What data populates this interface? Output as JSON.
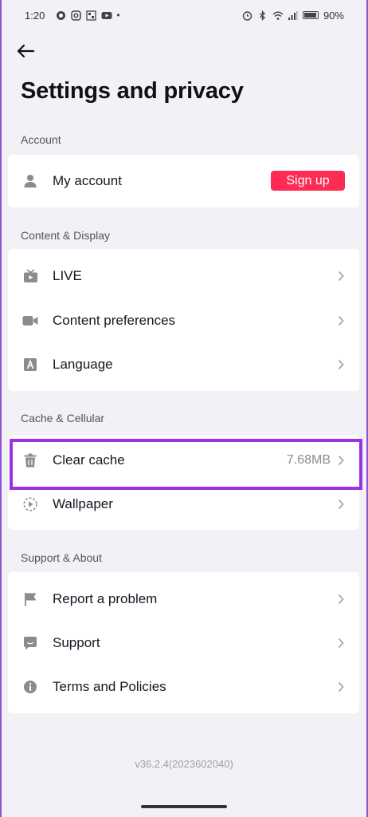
{
  "status_bar": {
    "time": "1:20",
    "battery_text": "90%"
  },
  "page": {
    "title": "Settings and privacy"
  },
  "sections": [
    {
      "label": "Account",
      "items": [
        {
          "label": "My account",
          "icon": "person-icon",
          "action_label": "Sign up"
        }
      ]
    },
    {
      "label": "Content & Display",
      "items": [
        {
          "label": "LIVE",
          "icon": "tv-icon"
        },
        {
          "label": "Content preferences",
          "icon": "video-camera-icon"
        },
        {
          "label": "Language",
          "icon": "language-icon"
        }
      ]
    },
    {
      "label": "Cache & Cellular",
      "items": [
        {
          "label": "Clear cache",
          "icon": "trash-icon",
          "value": "7.68MB"
        },
        {
          "label": "Wallpaper",
          "icon": "wallpaper-icon"
        }
      ]
    },
    {
      "label": "Support & About",
      "items": [
        {
          "label": "Report a problem",
          "icon": "flag-icon"
        },
        {
          "label": "Support",
          "icon": "chat-icon"
        },
        {
          "label": "Terms and Policies",
          "icon": "info-icon"
        }
      ]
    }
  ],
  "footer": {
    "version": "v36.2.4(2023602040)"
  },
  "colors": {
    "accent": "#fe2c55",
    "highlight": "#9b30e6",
    "background": "#f2f1f6"
  }
}
